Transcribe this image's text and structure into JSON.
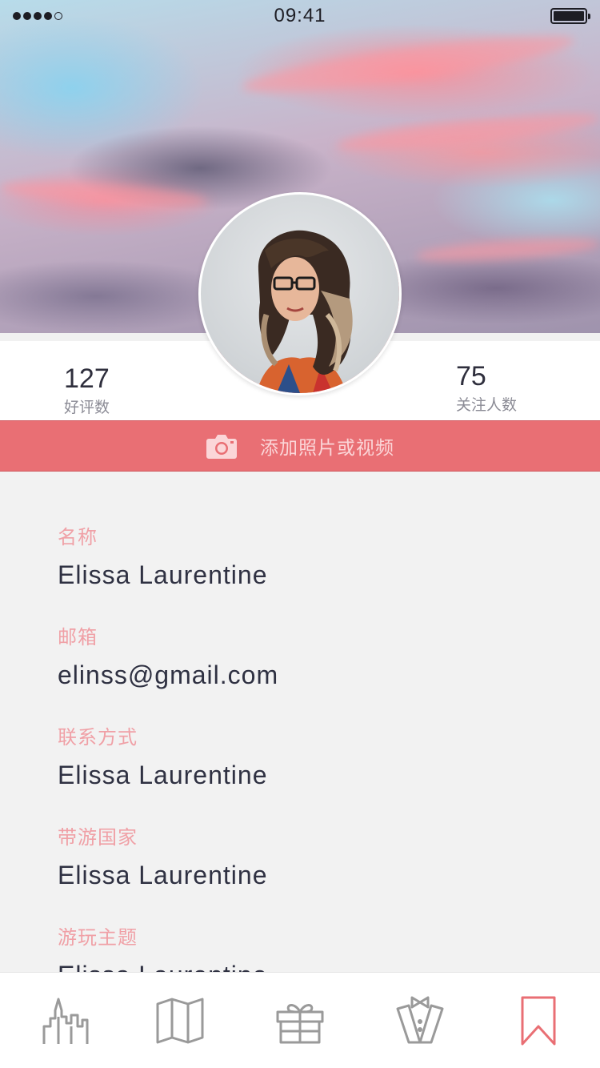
{
  "status_bar": {
    "time": "09:41",
    "signal_filled": 4,
    "signal_total": 5,
    "battery_level": 1.0
  },
  "stats": {
    "left": {
      "value": "127",
      "label": "好评数"
    },
    "right": {
      "value": "75",
      "label": "关注人数"
    }
  },
  "add_media": {
    "label": "添加照片或视频",
    "icon": "camera-icon"
  },
  "profile": {
    "fields": [
      {
        "label": "名称",
        "value": "Elissa Laurentine"
      },
      {
        "label": "邮箱",
        "value": "elinss@gmail.com"
      },
      {
        "label": "联系方式",
        "value": "Elissa Laurentine"
      },
      {
        "label": "带游国家",
        "value": "Elissa Laurentine"
      },
      {
        "label": "游玩主题",
        "value": "Elissa Laurentine"
      }
    ]
  },
  "tabbar": {
    "tabs": [
      {
        "icon": "city-icon",
        "active": false
      },
      {
        "icon": "map-icon",
        "active": false
      },
      {
        "icon": "gift-icon",
        "active": false
      },
      {
        "icon": "tuxedo-icon",
        "active": false
      },
      {
        "icon": "bookmark-icon",
        "active": true
      }
    ]
  },
  "colors": {
    "accent": "#e96f74",
    "label_pink": "#f0a0a6",
    "icon_gray": "#9a9a9a",
    "background": "#f2f2f2"
  }
}
